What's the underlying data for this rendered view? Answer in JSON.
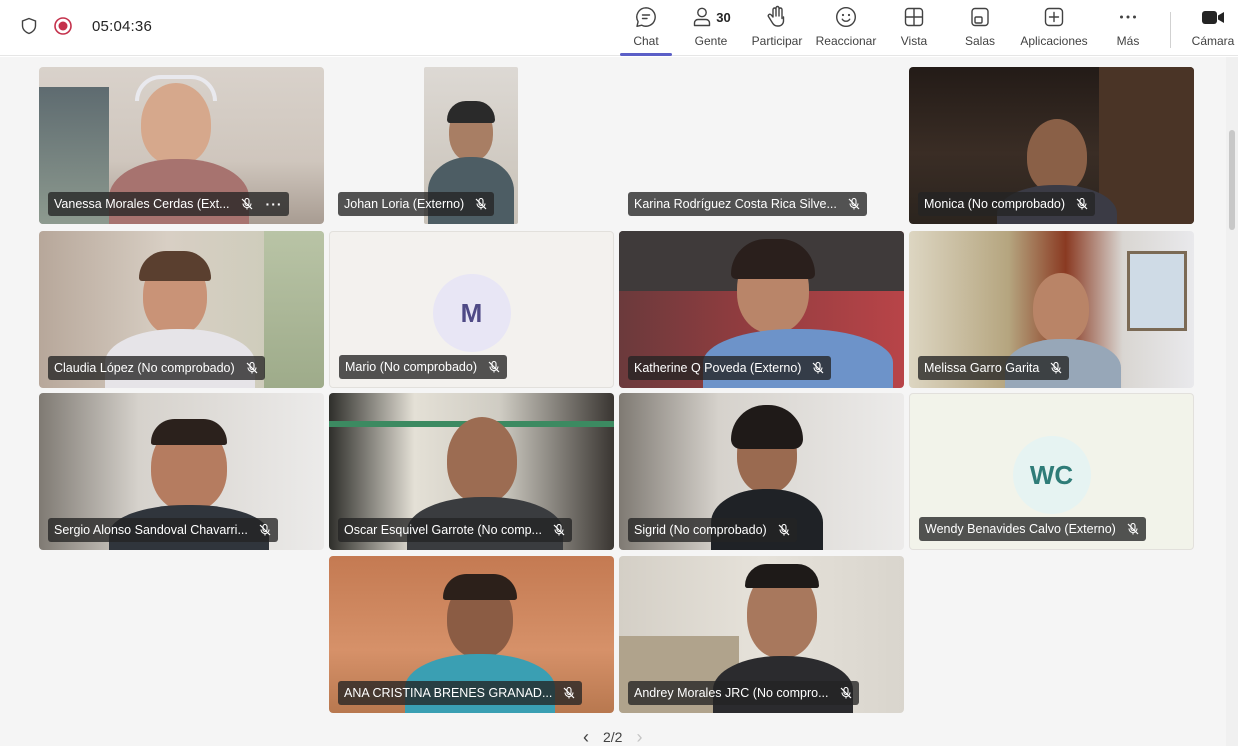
{
  "status": {
    "timer": "05:04:36",
    "shield_icon": "shield-icon",
    "recording_icon": "recording-icon",
    "recording_color": "#c4314b"
  },
  "toolbar": {
    "items": [
      {
        "id": "chat",
        "label": "Chat",
        "icon": "chat-icon",
        "active": true
      },
      {
        "id": "people",
        "label": "Gente",
        "icon": "people-icon",
        "count": "30"
      },
      {
        "id": "raise-hand",
        "label": "Participar",
        "icon": "raise-hand-icon"
      },
      {
        "id": "react",
        "label": "Reaccionar",
        "icon": "smile-icon"
      },
      {
        "id": "view",
        "label": "Vista",
        "icon": "grid-icon"
      },
      {
        "id": "rooms",
        "label": "Salas",
        "icon": "rooms-icon"
      },
      {
        "id": "apps",
        "label": "Aplicaciones",
        "icon": "plus-box-icon"
      },
      {
        "id": "more",
        "label": "Más",
        "icon": "more-icon"
      },
      {
        "id": "camera",
        "label": "Cámara",
        "icon": "camera-icon"
      }
    ],
    "accent_color": "#5b5fc7"
  },
  "participants": [
    {
      "name": "Vanessa Morales Cerdas (Ext...",
      "muted": true,
      "has_more": true,
      "video": true
    },
    {
      "name": "Johan Loria (Externo)",
      "muted": true,
      "video": true
    },
    {
      "name": "Karina Rodríguez Costa Rica Silve...",
      "muted": true,
      "video": false
    },
    {
      "name": "Monica (No comprobado)",
      "muted": true,
      "video": true
    },
    {
      "name": "Claudia López (No comprobado)",
      "muted": true,
      "video": true
    },
    {
      "name": "Mario (No comprobado)",
      "muted": true,
      "video": false,
      "initials": "M",
      "avatar_bg": "#e8e6f5",
      "avatar_fg": "#4f4a86"
    },
    {
      "name": "Katherine Q Poveda (Externo)",
      "muted": true,
      "video": true
    },
    {
      "name": "Melissa Garro Garita",
      "muted": true,
      "video": true
    },
    {
      "name": "Sergio Alonso Sandoval Chavarri...",
      "muted": true,
      "video": true
    },
    {
      "name": "Oscar Esquivel Garrote (No comp...",
      "muted": true,
      "video": true
    },
    {
      "name": "Sigrid (No comprobado)",
      "muted": true,
      "video": true
    },
    {
      "name": "Wendy Benavides Calvo (Externo)",
      "muted": true,
      "video": false,
      "initials": "WC",
      "avatar_bg": "#e6f3f2",
      "avatar_fg": "#2f7c78"
    },
    {
      "name": "ANA CRISTINA BRENES GRANAD...",
      "muted": true,
      "video": true
    },
    {
      "name": "Andrey Morales JRC (No compro...",
      "muted": true,
      "video": true
    }
  ],
  "pagination": {
    "page_label": "2/2",
    "prev_icon": "chevron-left-icon",
    "next_icon": "chevron-right-icon"
  }
}
